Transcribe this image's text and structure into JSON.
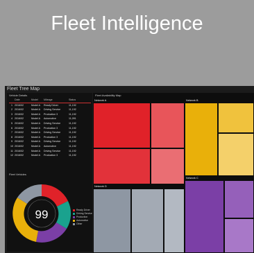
{
  "banner": {
    "title": "Fleet Intelligence"
  },
  "app": {
    "title": "Fleet Tree Map",
    "table_title": "Vehicle Details",
    "columns": [
      "",
      "Date",
      "Model",
      "Mileage",
      "Status"
    ],
    "rows": [
      [
        "1",
        "2016/02",
        "Model A",
        "Ready Driver",
        "11,192"
      ],
      [
        "2",
        "2016/02",
        "Model A",
        "Driving Service",
        "11,192"
      ],
      [
        "3",
        "2016/02",
        "Model A",
        "Production 3",
        "11,192"
      ],
      [
        "4",
        "2016/02",
        "Model A",
        "Automotive",
        "11,091"
      ],
      [
        "5",
        "2016/02",
        "Model A",
        "Driving Service",
        "11,192"
      ],
      [
        "6",
        "2016/02",
        "Model A",
        "Production 3",
        "11,192"
      ],
      [
        "7",
        "2016/02",
        "Model A",
        "Driving Service",
        "11,192"
      ],
      [
        "8",
        "2016/02",
        "Model A",
        "Production 3",
        "11,192"
      ],
      [
        "9",
        "2016/02",
        "Model A",
        "Driving Service",
        "11,192"
      ],
      [
        "10",
        "2016/02",
        "Model A",
        "Automotive",
        "11,192"
      ],
      [
        "11",
        "2016/02",
        "Model A",
        "Driving Service",
        "11,192"
      ],
      [
        "12",
        "2016/02",
        "Model A",
        "Production 3",
        "11,192"
      ]
    ],
    "ring_title": "Fleet Vehicles",
    "ring_value": "99",
    "legend": [
      "Ready Driver",
      "Driving Service",
      "Production",
      "Automotive",
      "Other"
    ],
    "treemap_title": "Fleet Availability Map",
    "groups": {
      "red": "Network A",
      "yellow": "Network B",
      "purple": "Network C",
      "gray": "Network D"
    }
  },
  "colors": {
    "red": "#e02229",
    "yellow": "#e9b00a",
    "purple": "#7b3fa6",
    "gray": "#8e97a3",
    "teal": "#1aa28e"
  }
}
